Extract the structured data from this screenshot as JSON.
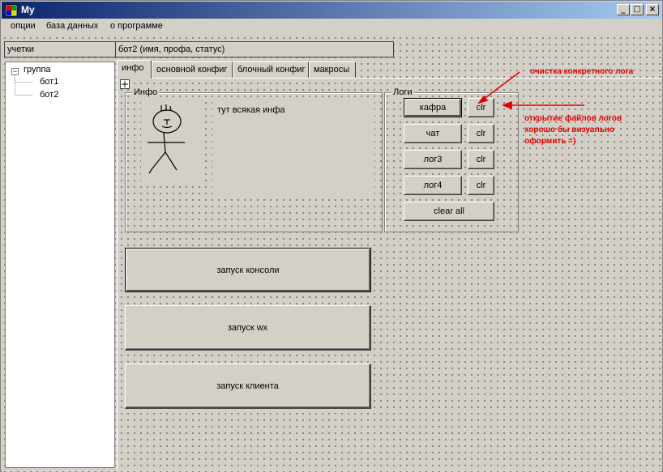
{
  "window": {
    "title": "My",
    "minimize_glyph": "_",
    "maximize_glyph": "□",
    "close_glyph": "×"
  },
  "menu": {
    "items": [
      "опции",
      "база данных",
      "о программе"
    ]
  },
  "header_labels": {
    "accounts": "учетки",
    "status": "бот2 (имя, профа, статус)"
  },
  "tree": {
    "group": {
      "label": "группа",
      "expander": "−"
    },
    "children": [
      "бот1",
      "бот2"
    ]
  },
  "tabs": [
    {
      "label": "инфо",
      "active": true
    },
    {
      "label": "основной конфиг",
      "active": false
    },
    {
      "label": "блочный конфиг",
      "active": false
    },
    {
      "label": "макросы",
      "active": false
    }
  ],
  "info_group": {
    "title": "Инфо",
    "text": "тут всякая инфа",
    "avatar_icon": "stick-figure-icon"
  },
  "logs_group": {
    "title": "Логи",
    "logs": [
      {
        "label": "кафра",
        "clear": "clr"
      },
      {
        "label": "чат",
        "clear": "clr"
      },
      {
        "label": "лог3",
        "clear": "clr"
      },
      {
        "label": "лог4",
        "clear": "clr"
      }
    ],
    "clear_all": "clear all"
  },
  "actions": {
    "console": "запуск консоли",
    "wx": "запуск wx",
    "client": "запуск клиента"
  },
  "annotations": {
    "clear_log": "очистка конкретного лога",
    "open_logs_line1": "открытие файлов логов",
    "open_logs_line2": "хорошо бы визуально",
    "open_logs_line3": "оформить =)",
    "color": "#e60000"
  }
}
